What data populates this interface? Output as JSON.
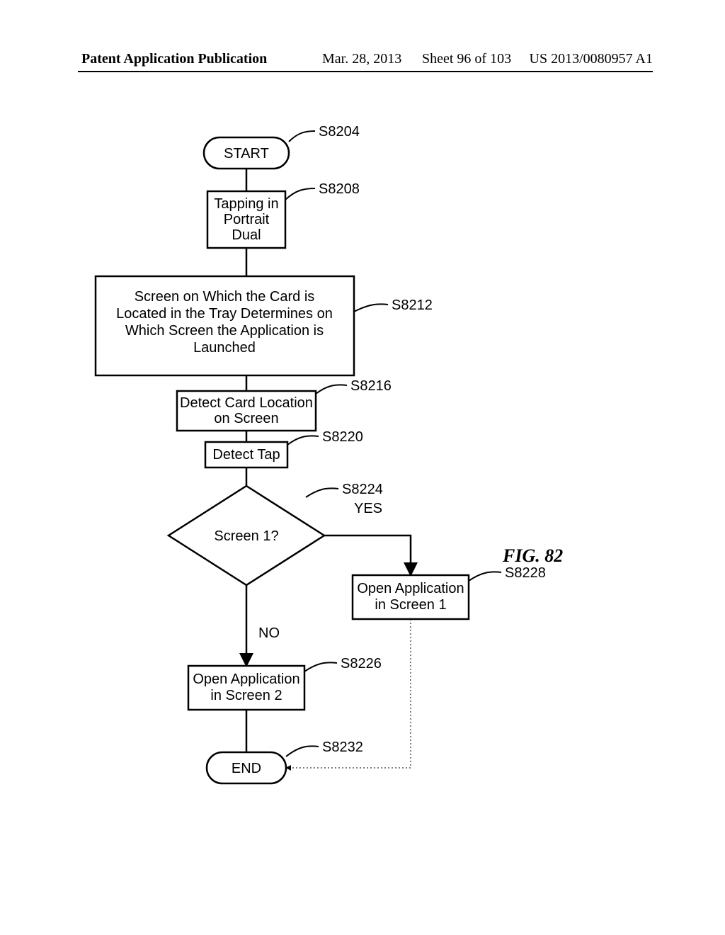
{
  "header": {
    "left": "Patent Application Publication",
    "date": "Mar. 28, 2013",
    "sheet": "Sheet 96 of 103",
    "pub": "US 2013/0080957 A1"
  },
  "figure_title": "FIG. 82",
  "nodes": {
    "start": "START",
    "tapping_l1": "Tapping in",
    "tapping_l2": "Portrait",
    "tapping_l3": "Dual",
    "desc_l1": "Screen on Which the Card is",
    "desc_l2": "Located in the Tray Determines on",
    "desc_l3": "Which Screen the Application is",
    "desc_l4": "Launched",
    "detect_loc_l1": "Detect Card Location",
    "detect_loc_l2": "on Screen",
    "detect_tap": "Detect Tap",
    "decision": "Screen 1?",
    "open1_l1": "Open Application",
    "open1_l2": "in Screen 1",
    "open2_l1": "Open Application",
    "open2_l2": "in Screen 2",
    "end": "END"
  },
  "refs": {
    "s8204": "S8204",
    "s8208": "S8208",
    "s8212": "S8212",
    "s8216": "S8216",
    "s8220": "S8220",
    "s8224": "S8224",
    "s8226": "S8226",
    "s8228": "S8228",
    "s8232": "S8232"
  },
  "branches": {
    "yes": "YES",
    "no": "NO"
  },
  "chart_data": {
    "type": "flowchart",
    "title": "FIG. 82",
    "nodes": [
      {
        "id": "S8204",
        "shape": "terminator",
        "label": "START"
      },
      {
        "id": "S8208",
        "shape": "process",
        "label": "Tapping in Portrait Dual"
      },
      {
        "id": "S8212",
        "shape": "process",
        "label": "Screen on Which the Card is Located in the Tray Determines on Which Screen the Application is Launched"
      },
      {
        "id": "S8216",
        "shape": "process",
        "label": "Detect Card Location on Screen"
      },
      {
        "id": "S8220",
        "shape": "process",
        "label": "Detect Tap"
      },
      {
        "id": "S8224",
        "shape": "decision",
        "label": "Screen 1?"
      },
      {
        "id": "S8228",
        "shape": "process",
        "label": "Open Application in Screen 1"
      },
      {
        "id": "S8226",
        "shape": "process",
        "label": "Open Application in Screen 2"
      },
      {
        "id": "S8232",
        "shape": "terminator",
        "label": "END"
      }
    ],
    "edges": [
      {
        "from": "S8204",
        "to": "S8208"
      },
      {
        "from": "S8208",
        "to": "S8212"
      },
      {
        "from": "S8212",
        "to": "S8216"
      },
      {
        "from": "S8216",
        "to": "S8220"
      },
      {
        "from": "S8220",
        "to": "S8224"
      },
      {
        "from": "S8224",
        "to": "S8228",
        "label": "YES"
      },
      {
        "from": "S8224",
        "to": "S8226",
        "label": "NO"
      },
      {
        "from": "S8226",
        "to": "S8232"
      },
      {
        "from": "S8228",
        "to": "S8232"
      }
    ]
  }
}
